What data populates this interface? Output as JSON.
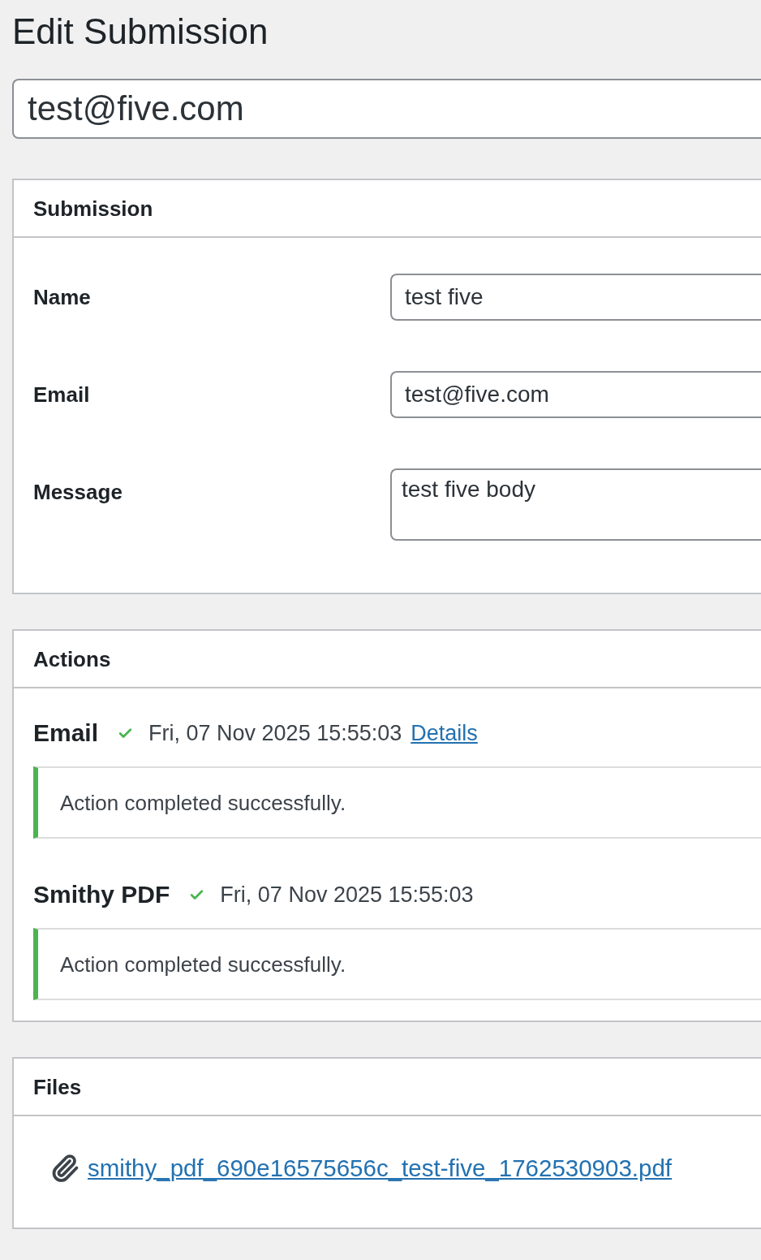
{
  "page_title": "Edit Submission",
  "title_field": {
    "value": "test@five.com"
  },
  "submission_panel": {
    "heading": "Submission",
    "fields": [
      {
        "label": "Name",
        "kind": "input",
        "value": "test five"
      },
      {
        "label": "Email",
        "kind": "input",
        "value": "test@five.com"
      },
      {
        "label": "Message",
        "kind": "textarea",
        "value": "test five body"
      }
    ]
  },
  "actions_panel": {
    "heading": "Actions",
    "actions": [
      {
        "name": "Email",
        "success": true,
        "time": "Fri, 07 Nov 2025 15:55:03",
        "link": "Details",
        "notice": "Action completed successfully."
      },
      {
        "name": "Smithy PDF",
        "success": true,
        "time": "Fri, 07 Nov 2025 15:55:03",
        "notice": "Action completed successfully."
      }
    ]
  },
  "files_panel": {
    "heading": "Files",
    "files": [
      {
        "name": "smithy_pdf_690e16575656c_test-five_1762530903.pdf"
      }
    ]
  }
}
